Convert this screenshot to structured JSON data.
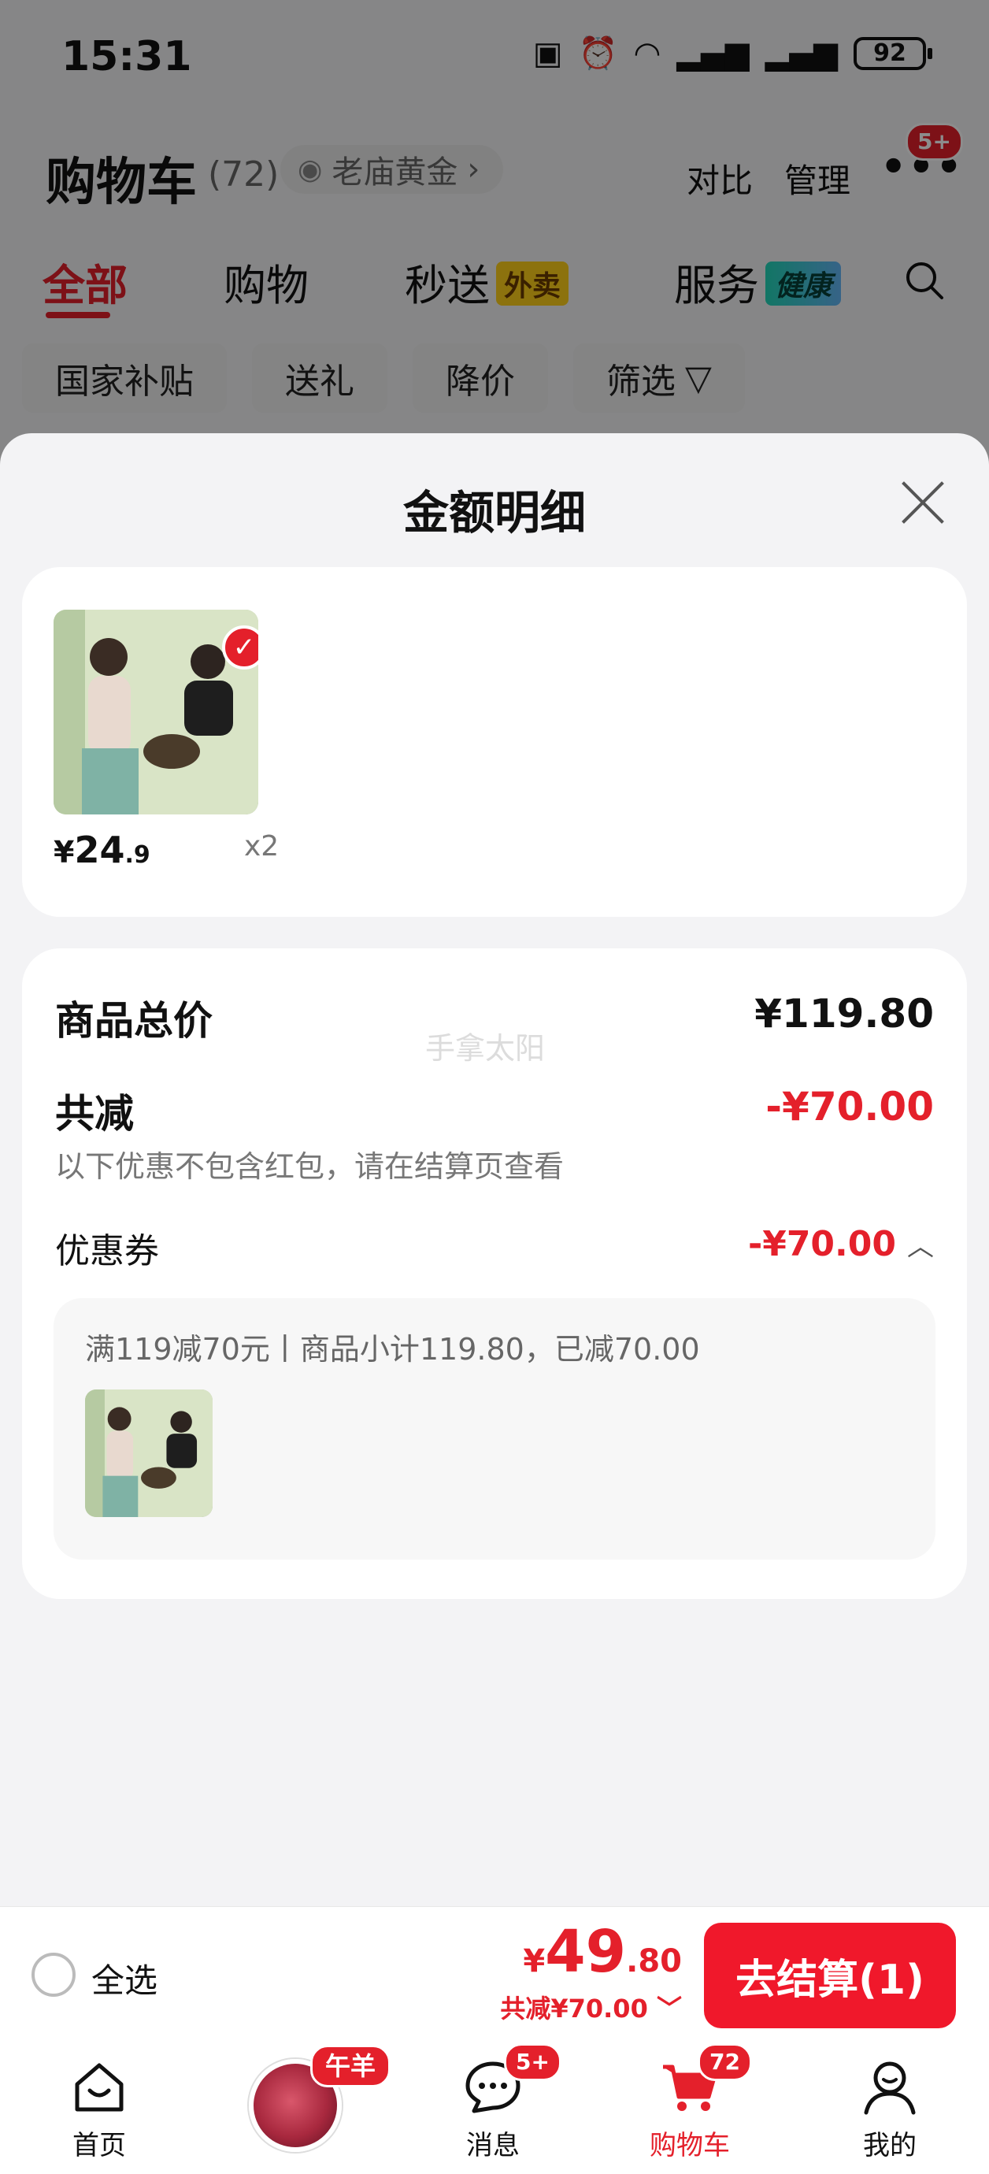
{
  "status_bar": {
    "time": "15:31",
    "battery": "92"
  },
  "header": {
    "title": "购物车",
    "count": "(72)",
    "gold_pill": "老庙黄金",
    "compare": "对比",
    "manage": "管理",
    "more_badge": "5+"
  },
  "tabs": [
    {
      "label": "全部"
    },
    {
      "label": "购物"
    },
    {
      "label": "秒送",
      "tag": "外卖"
    },
    {
      "label": "服务",
      "tag": "健康"
    }
  ],
  "chips": [
    {
      "label": "国家补贴"
    },
    {
      "label": "送礼"
    },
    {
      "label": "降价"
    },
    {
      "label": "筛选"
    }
  ],
  "sheet": {
    "title": "金额明细",
    "item": {
      "price_currency": "¥",
      "price_int": "24",
      "price_dec": ".9",
      "quantity": "x2"
    },
    "summary": {
      "total_label": "商品总价",
      "total_value": "¥119.80",
      "reduce_label": "共减",
      "reduce_value": "-¥70.00",
      "note": "以下优惠不包含红包，请在结算页查看",
      "coupon_label": "优惠券",
      "coupon_value": "-¥70.00",
      "coupon_desc": "满119减70元丨商品小计119.80，已减70.00",
      "watermark": "手拿太阳"
    }
  },
  "checkout": {
    "select_all": "全选",
    "total_currency": "¥",
    "total_int": "49",
    "total_dec": ".80",
    "saved": "共减¥70.00",
    "button": "去结算(1)"
  },
  "bottom_nav": {
    "promo_tag": "午羊",
    "items": [
      {
        "label": "首页"
      },
      {
        "label": "消息",
        "badge": "5+"
      },
      {
        "label": "购物车",
        "badge": "72"
      },
      {
        "label": "我的"
      }
    ]
  },
  "colors": {
    "accent": "#e4202b",
    "checkout_button": "#f0182b"
  }
}
